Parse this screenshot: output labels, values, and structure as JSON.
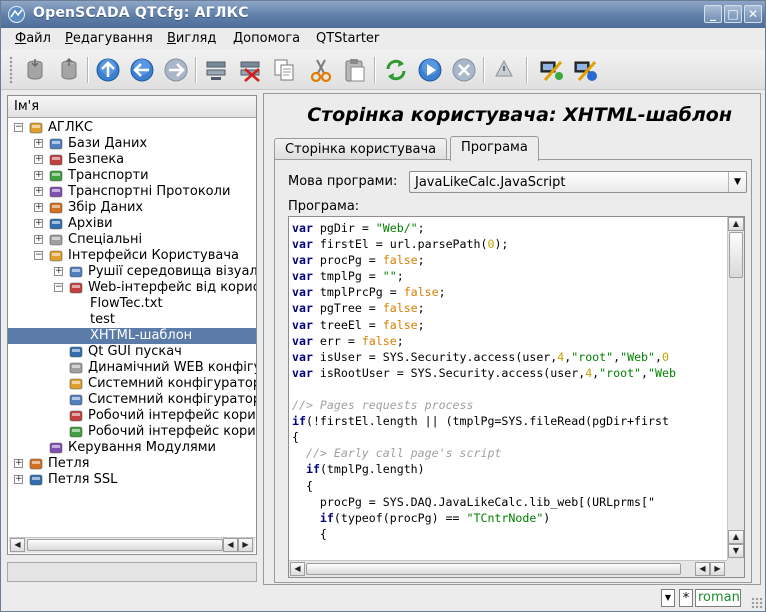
{
  "window": {
    "title": "OpenSCADA QTCfg: АГЛКС",
    "minimize_icon": "minimize-icon",
    "maximize_icon": "maximize-icon",
    "close_icon": "close-icon"
  },
  "menu": [
    {
      "accel": "Ф",
      "rest": "айл"
    },
    {
      "accel": "Р",
      "rest": "едагування"
    },
    {
      "accel": "В",
      "rest": "игляд"
    },
    {
      "accel": "Д",
      "rest": "опомога"
    },
    {
      "accel": "",
      "rest": "QTStarter"
    }
  ],
  "toolbar": {
    "tools": [
      "db-load-icon",
      "db-save-icon",
      "up-icon",
      "back-icon",
      "forward-icon",
      "add-item-icon",
      "delete-item-icon",
      "copy-icon",
      "cut-icon",
      "paste-icon",
      "reload-icon",
      "start-icon",
      "stop-icon",
      "info-icon",
      "server-connect-icon",
      "server-disconnect-icon"
    ]
  },
  "tree": {
    "header": "Ім'я",
    "items": [
      {
        "label": "АГЛКС",
        "level": 0,
        "expander": "−",
        "icon": "station-icon"
      },
      {
        "label": "Бази Даних",
        "level": 1,
        "expander": "+",
        "icon": "database-icon"
      },
      {
        "label": "Безпека",
        "level": 1,
        "expander": "+",
        "icon": "security-icon"
      },
      {
        "label": "Транспорти",
        "level": 1,
        "expander": "+",
        "icon": "transport-icon"
      },
      {
        "label": "Транспортні Протоколи",
        "level": 1,
        "expander": "+",
        "icon": "protocol-icon"
      },
      {
        "label": "Збір Даних",
        "level": 1,
        "expander": "+",
        "icon": "daq-icon"
      },
      {
        "label": "Архіви",
        "level": 1,
        "expander": "+",
        "icon": "archive-icon"
      },
      {
        "label": "Спеціальні",
        "level": 1,
        "expander": "+",
        "icon": "special-icon"
      },
      {
        "label": "Інтерфейси Користувача",
        "level": 1,
        "expander": "−",
        "icon": "ui-icon"
      },
      {
        "label": "Рушії середовища візуалізації",
        "level": 2,
        "expander": "+",
        "icon": "vis-engine-icon"
      },
      {
        "label": "Web-інтерфейс від користувача",
        "level": 2,
        "expander": "−",
        "icon": "web-ui-icon"
      },
      {
        "label": "FlowTec.txt",
        "level": 3,
        "expander": "",
        "icon": ""
      },
      {
        "label": "test",
        "level": 3,
        "expander": "",
        "icon": ""
      },
      {
        "label": "XHTML-шаблон",
        "level": 3,
        "expander": "",
        "icon": "",
        "selected": true
      },
      {
        "label": "Qt GUI пускач",
        "level": 2,
        "expander": "",
        "icon": "qt-starter-icon"
      },
      {
        "label": "Динамічний WEB конфігуратор",
        "level": 2,
        "expander": "",
        "icon": "web-config-icon"
      },
      {
        "label": "Системний конфігуратор (Qt)",
        "level": 2,
        "expander": "",
        "icon": "sys-config-icon"
      },
      {
        "label": "Системний конфігуратор (WEB)",
        "level": 2,
        "expander": "",
        "icon": "sys-config-web-icon"
      },
      {
        "label": "Робочий інтерфейс користувача (Qt)",
        "level": 2,
        "expander": "",
        "icon": "work-ui-icon"
      },
      {
        "label": "Робочий інтерфейс користувача (WEB)",
        "level": 2,
        "expander": "",
        "icon": "work-ui-web-icon"
      },
      {
        "label": "Керування Модулями",
        "level": 1,
        "expander": "",
        "icon": "modules-icon"
      },
      {
        "label": "Петля",
        "level": 0,
        "expander": "+",
        "icon": "station-icon"
      },
      {
        "label": "Петля SSL",
        "level": 0,
        "expander": "+",
        "icon": "station-icon"
      }
    ]
  },
  "page": {
    "title": "Сторінка користувача: XHTML-шаблон",
    "tabs": [
      "Сторінка користувача",
      "Програма"
    ],
    "active_tab": 1,
    "lang_label": "Мова програми:",
    "lang_value": "JavaLikeCalc.JavaScript",
    "program_label": "Програма:"
  },
  "code_lines": [
    [
      [
        "kw",
        "var"
      ],
      [
        "t",
        " pgDir = "
      ],
      [
        "str",
        "\"Web/\""
      ],
      [
        "t",
        ";"
      ]
    ],
    [
      [
        "kw",
        "var"
      ],
      [
        "t",
        " firstEl = url.parsePath("
      ],
      [
        "num",
        "0"
      ],
      [
        "t",
        ");"
      ]
    ],
    [
      [
        "kw",
        "var"
      ],
      [
        "t",
        " procPg = "
      ],
      [
        "bool",
        "false"
      ],
      [
        "t",
        ";"
      ]
    ],
    [
      [
        "kw",
        "var"
      ],
      [
        "t",
        " tmplPg = "
      ],
      [
        "str",
        "\"\""
      ],
      [
        "t",
        ";"
      ]
    ],
    [
      [
        "kw",
        "var"
      ],
      [
        "t",
        " tmplPrcPg = "
      ],
      [
        "bool",
        "false"
      ],
      [
        "t",
        ";"
      ]
    ],
    [
      [
        "kw",
        "var"
      ],
      [
        "t",
        " pgTree = "
      ],
      [
        "bool",
        "false"
      ],
      [
        "t",
        ";"
      ]
    ],
    [
      [
        "kw",
        "var"
      ],
      [
        "t",
        " treeEl = "
      ],
      [
        "bool",
        "false"
      ],
      [
        "t",
        ";"
      ]
    ],
    [
      [
        "kw",
        "var"
      ],
      [
        "t",
        " err = "
      ],
      [
        "bool",
        "false"
      ],
      [
        "t",
        ";"
      ]
    ],
    [
      [
        "kw",
        "var"
      ],
      [
        "t",
        " isUser = SYS.Security.access(user,"
      ],
      [
        "num",
        "4"
      ],
      [
        "t",
        ","
      ],
      [
        "str",
        "\"root\""
      ],
      [
        "t",
        ","
      ],
      [
        "str",
        "\"Web\""
      ],
      [
        "t",
        ","
      ],
      [
        "num",
        "0"
      ]
    ],
    [
      [
        "kw",
        "var"
      ],
      [
        "t",
        " isRootUser = SYS.Security.access(user,"
      ],
      [
        "num",
        "4"
      ],
      [
        "t",
        ","
      ],
      [
        "str",
        "\"root\""
      ],
      [
        "t",
        ","
      ],
      [
        "str",
        "\"Web"
      ]
    ],
    [],
    [
      [
        "cmt",
        "//> Pages requests process"
      ]
    ],
    [
      [
        "kw",
        "if"
      ],
      [
        "t",
        "(!firstEl.length || (tmplPg=SYS.fileRead(pgDir+first"
      ]
    ],
    [
      [
        "t",
        "{"
      ]
    ],
    [
      [
        "t",
        "  "
      ],
      [
        "cmt",
        "//> Early call page's script"
      ]
    ],
    [
      [
        "t",
        "  "
      ],
      [
        "kw",
        "if"
      ],
      [
        "t",
        "(tmplPg.length)"
      ]
    ],
    [
      [
        "t",
        "  {"
      ]
    ],
    [
      [
        "t",
        "    procPg = SYS.DAQ.JavaLikeCalc.lib_web[(URLprms[\""
      ]
    ],
    [
      [
        "t",
        "    "
      ],
      [
        "kw",
        "if"
      ],
      [
        "t",
        "(typeof(procPg) == "
      ],
      [
        "str",
        "\"TCntrNode\""
      ],
      [
        "t",
        ")"
      ]
    ],
    [
      [
        "t",
        "    {"
      ]
    ]
  ],
  "status": {
    "user": "roman",
    "star": "*"
  }
}
